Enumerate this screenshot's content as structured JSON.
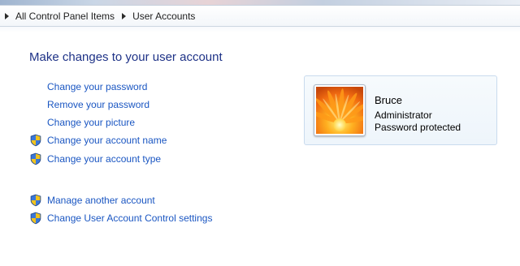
{
  "breadcrumb": {
    "items": [
      "All Control Panel Items",
      "User Accounts"
    ]
  },
  "page": {
    "title": "Make changes to your user account"
  },
  "tasks": [
    {
      "label": "Change your password",
      "shield": false
    },
    {
      "label": "Remove your password",
      "shield": false
    },
    {
      "label": "Change your picture",
      "shield": false
    },
    {
      "label": "Change your account name",
      "shield": true
    },
    {
      "label": "Change your account type",
      "shield": true
    }
  ],
  "more_tasks": [
    {
      "label": "Manage another account",
      "shield": true
    },
    {
      "label": "Change User Account Control settings",
      "shield": true
    }
  ],
  "user": {
    "name": "Bruce",
    "role": "Administrator",
    "status": "Password protected",
    "picture": "orange-flower-picture"
  },
  "colors": {
    "title": "#1e3287",
    "link": "#1a56c2",
    "card_border": "#c9dbee"
  }
}
